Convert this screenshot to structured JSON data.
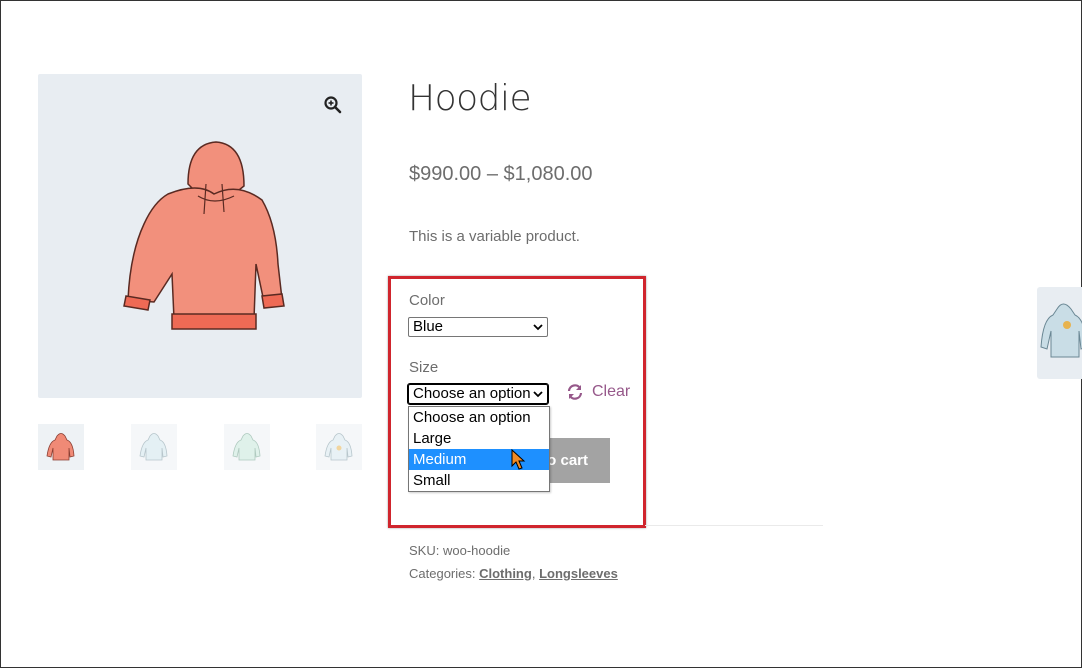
{
  "product": {
    "title": "Hoodie",
    "price": "$990.00 – $1,080.00",
    "description": "This is a variable product."
  },
  "gallery": {
    "main_image": "pink-hoodie-image",
    "thumbnails": [
      "pink-hoodie",
      "blue-hoodie",
      "green-hoodie",
      "blue-logo-hoodie"
    ]
  },
  "variations": {
    "color_label": "Color",
    "color_value": "Blue",
    "size_label": "Size",
    "size_value": "Choose an option",
    "clear_label": "Clear",
    "size_options": [
      "Choose an option",
      "Large",
      "Medium",
      "Small"
    ],
    "highlighted_option": "Medium"
  },
  "cart": {
    "add_to_cart_label": "o cart"
  },
  "meta": {
    "sku_label": "SKU:",
    "sku_value": "woo-hoodie",
    "categories_label": "Categories:",
    "categories": [
      "Clothing",
      "Longsleeves"
    ],
    "separator": ","
  },
  "colors": {
    "accent": "#96588a",
    "highlight_border": "#d0252d",
    "selected_option": "#1e90ff",
    "button_disabled": "#a3a3a3"
  }
}
